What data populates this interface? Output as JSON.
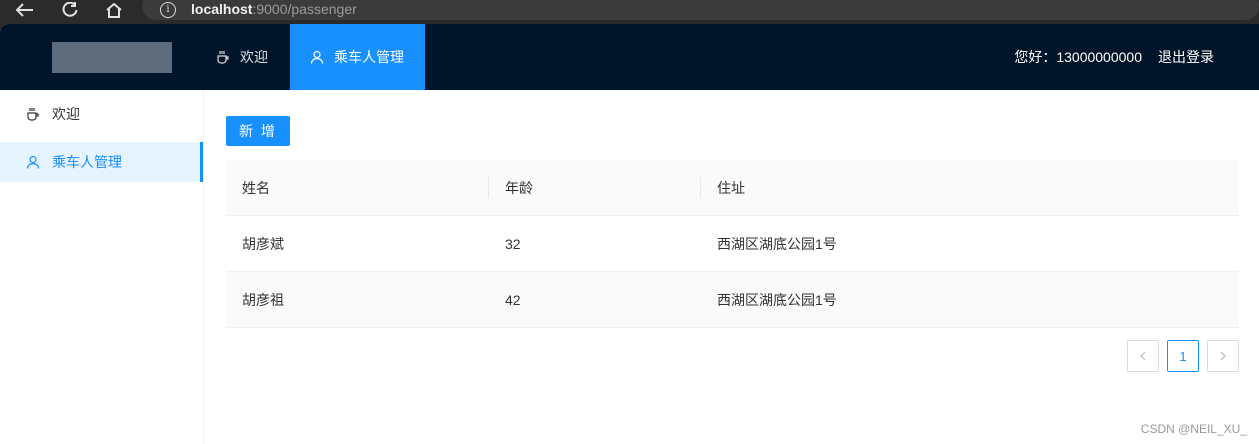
{
  "browser": {
    "url_host": "localhost",
    "url_rest": ":9000/passenger"
  },
  "topnav": {
    "items": [
      {
        "label": "欢迎",
        "icon": "coffee-icon"
      },
      {
        "label": "乘车人管理",
        "icon": "user-icon",
        "active": true
      }
    ],
    "greeting": "您好：13000000000",
    "logout": "退出登录"
  },
  "sidebar": {
    "items": [
      {
        "label": "欢迎",
        "icon": "coffee-icon"
      },
      {
        "label": "乘车人管理",
        "icon": "user-icon",
        "active": true
      }
    ]
  },
  "main": {
    "add_button": "新 增",
    "table": {
      "columns": [
        "姓名",
        "年龄",
        "住址"
      ],
      "rows": [
        [
          "胡彦斌",
          "32",
          "西湖区湖底公园1号"
        ],
        [
          "胡彦祖",
          "42",
          "西湖区湖底公园1号"
        ]
      ]
    },
    "pagination": {
      "prev": "<",
      "current": "1",
      "next": ">"
    }
  },
  "watermark": "CSDN @NEIL_XU_",
  "colors": {
    "primary": "#1890ff",
    "header_bg": "#001529"
  }
}
